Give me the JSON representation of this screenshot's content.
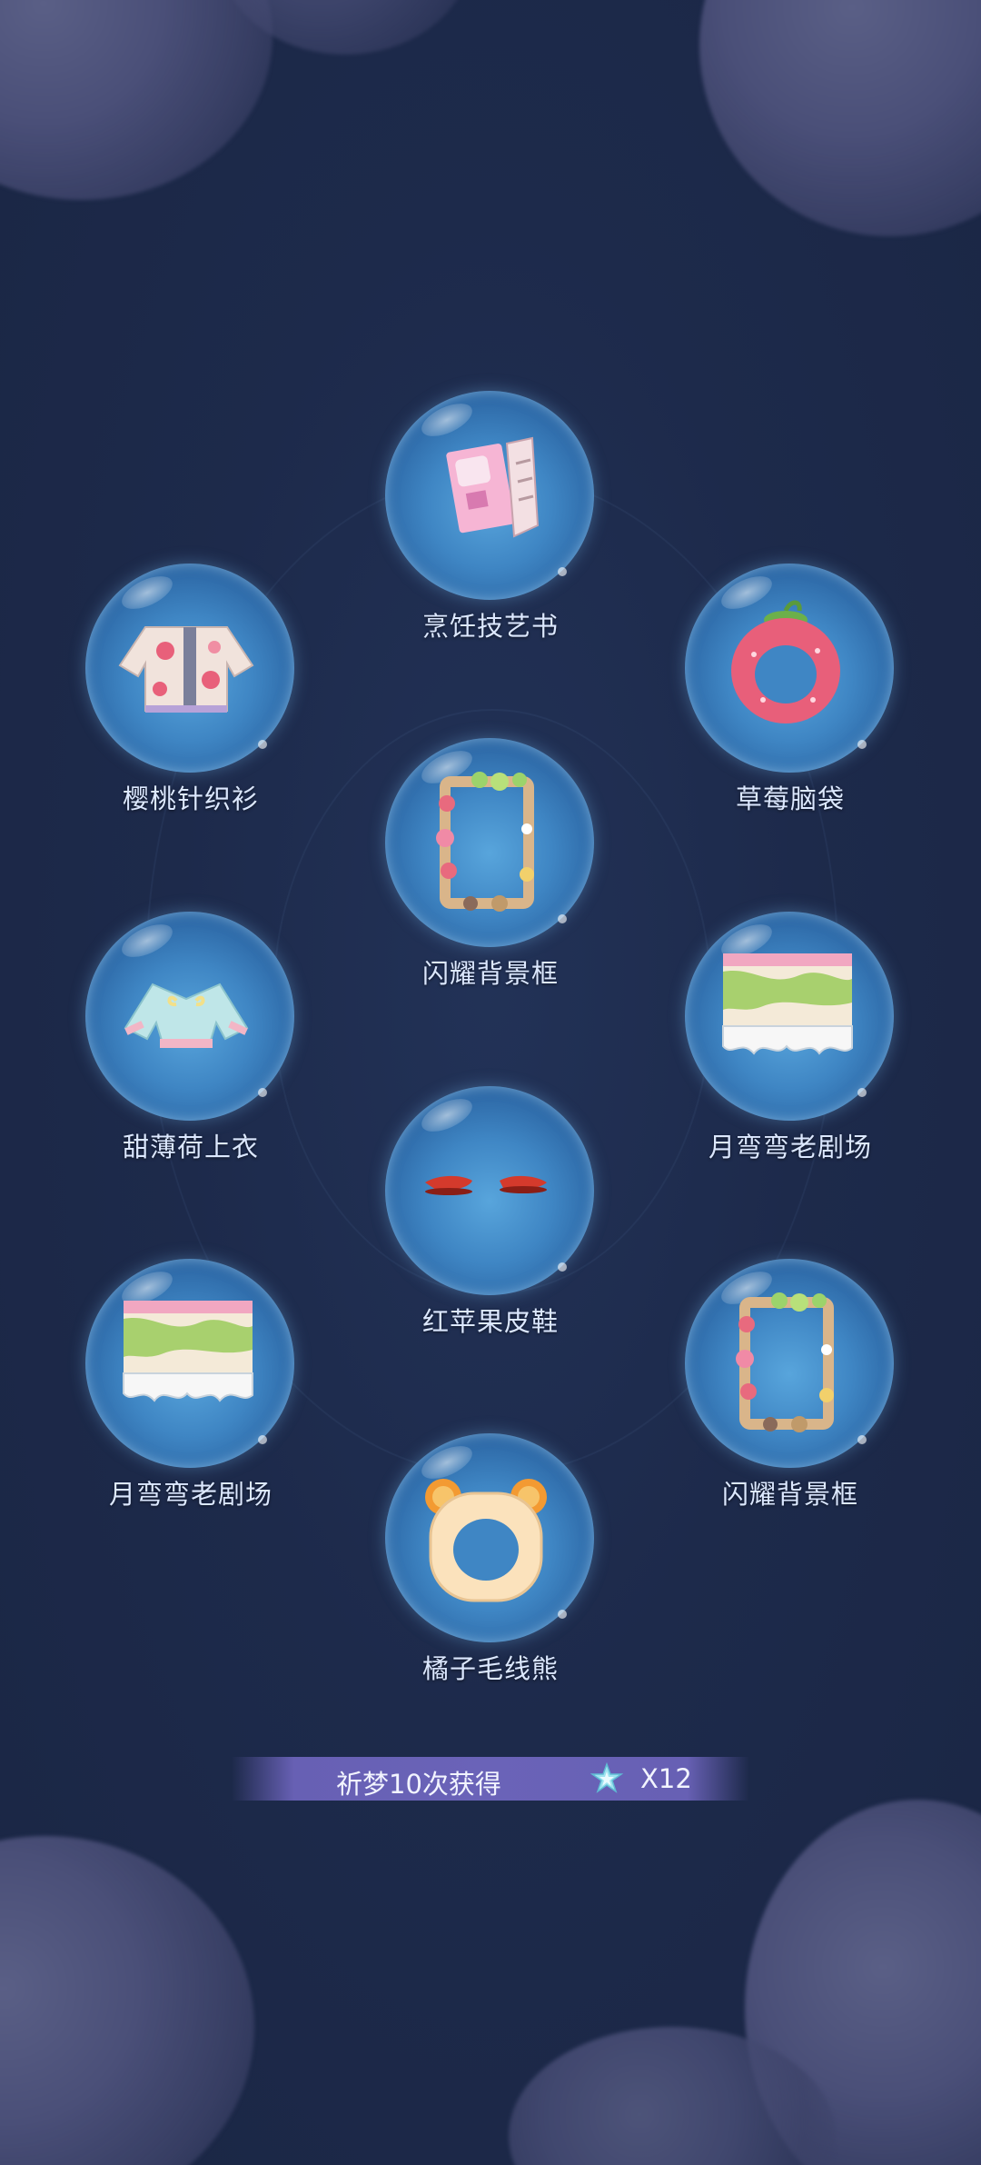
{
  "rewards": [
    {
      "name": "烹饪技艺书",
      "icon": "cookbook-icon"
    },
    {
      "name": "樱桃针织衫",
      "icon": "cherry-sweater-icon"
    },
    {
      "name": "草莓脑袋",
      "icon": "strawberry-headband-icon"
    },
    {
      "name": "闪耀背景框",
      "icon": "sparkle-frame-icon"
    },
    {
      "name": "甜薄荷上衣",
      "icon": "mint-top-icon"
    },
    {
      "name": "月弯弯老剧场",
      "icon": "theater-skirt-icon"
    },
    {
      "name": "红苹果皮鞋",
      "icon": "red-shoes-icon"
    },
    {
      "name": "月弯弯老剧场",
      "icon": "theater-skirt-icon"
    },
    {
      "name": "闪耀背景框",
      "icon": "sparkle-frame-icon"
    },
    {
      "name": "橘子毛线熊",
      "icon": "orange-bear-hood-icon"
    }
  ],
  "summary": {
    "text": "祈梦10次获得",
    "icon": "star-crystal-icon",
    "count": "X12"
  },
  "colors": {
    "background": "#1e2a4a",
    "bubble": "#3f86c4",
    "label": "#dce8ff",
    "summary_bar": "#6760b4"
  }
}
